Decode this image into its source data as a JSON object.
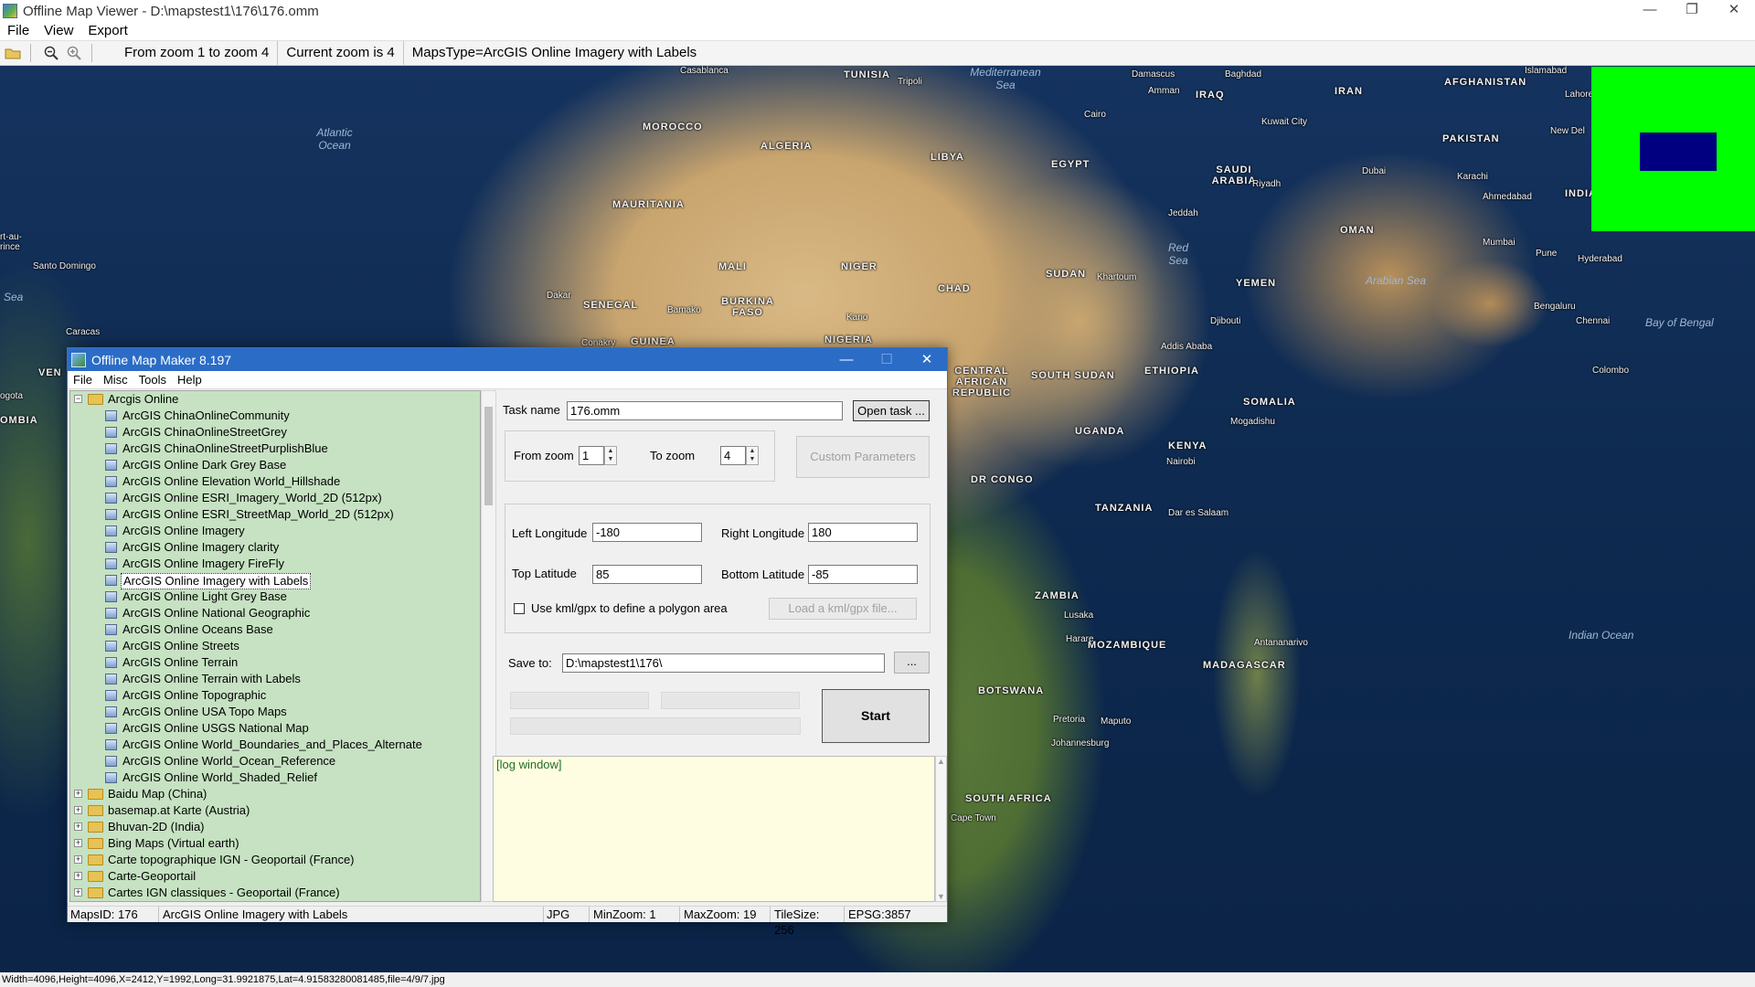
{
  "main_window": {
    "title": "Offline Map Viewer - D:\\mapstest1\\176\\176.omm",
    "controls": [
      "—",
      "❐",
      "✕"
    ]
  },
  "main_menu": [
    "File",
    "View",
    "Export"
  ],
  "toolbar": {
    "zoom_range": "From zoom 1 to zoom 4",
    "current_zoom": "Current zoom is 4",
    "maps_type": "MapsType=ArcGIS Online Imagery with Labels"
  },
  "map_labels": {
    "countries": [
      "TUNISIA",
      "MOROCCO",
      "ALGERIA",
      "LIBYA",
      "EGYPT",
      "SAUDI ARABIA",
      "IRAQ",
      "IRAN",
      "AFGHANISTAN",
      "PAKISTAN",
      "INDIA",
      "MAURITANIA",
      "MALI",
      "NIGER",
      "CHAD",
      "SUDAN",
      "YEMEN",
      "OMAN",
      "SENEGAL",
      "BURKINA FASO",
      "GUINEA",
      "NIGERIA",
      "CENTRAL AFRICAN REPUBLIC",
      "SOUTH SUDAN",
      "ETHIOPIA",
      "SOMALIA",
      "UGANDA",
      "KENYA",
      "DR CONGO",
      "TANZANIA",
      "ZAMBIA",
      "MOZAMBIQUE",
      "MADAGASCAR",
      "BOTSWANA",
      "SOUTH AFRICA",
      "VEN",
      "OMBIA"
    ],
    "cities": [
      "Casablanca",
      "Tripoli",
      "Damascus",
      "Baghdad",
      "Islamabad",
      "Lahore",
      "New Del",
      "Amman",
      "Cairo",
      "Kuwait City",
      "Riyadh",
      "Dubai",
      "Jeddah",
      "Karachi",
      "Ahmedabad",
      "Mumbai",
      "Pune",
      "Hyderabad",
      "Bengaluru",
      "Chennai",
      "Colombo",
      "Dakar",
      "Bamako",
      "Kano",
      "Conakry",
      "Khartoum",
      "Djibouti",
      "Addis Ababa",
      "Mogadishu",
      "Nairobi",
      "Dar es Salaam",
      "Lusaka",
      "Harare",
      "Antananarivo",
      "Pretoria",
      "Maputo",
      "Johannesburg",
      "Cape Town",
      "Santo Domingo",
      "Caracas",
      "ogota",
      "rt-au-rince"
    ],
    "oceans": [
      "Atlantic Ocean",
      "Mediterranean Sea",
      "Red Sea",
      "Arabian Sea",
      "Bay of Bengal",
      "Indian Ocean",
      "Sea"
    ]
  },
  "status_bar": "Width=4096,Height=4096,X=2412,Y=1992,Long=31.9921875,Lat=4.91583280081485,file=4/9/7.jpg",
  "dialog": {
    "title": "Offline Map Maker 8.197",
    "controls": [
      "—",
      "☐",
      "✕"
    ],
    "menu": [
      "File",
      "Misc",
      "Tools",
      "Help"
    ],
    "tree": {
      "root": "Arcgis Online",
      "children": [
        "ArcGIS ChinaOnlineCommunity",
        "ArcGIS ChinaOnlineStreetGrey",
        "ArcGIS ChinaOnlineStreetPurplishBlue",
        "ArcGIS Online Dark Grey Base",
        "ArcGIS Online Elevation World_Hillshade",
        "ArcGIS Online ESRI_Imagery_World_2D (512px)",
        "ArcGIS Online ESRI_StreetMap_World_2D (512px)",
        "ArcGIS Online Imagery",
        "ArcGIS Online Imagery clarity",
        "ArcGIS Online Imagery FireFly",
        "ArcGIS Online Imagery with Labels",
        "ArcGIS Online Light Grey Base",
        "ArcGIS Online National Geographic",
        "ArcGIS Online Oceans Base",
        "ArcGIS Online Streets",
        "ArcGIS Online Terrain",
        "ArcGIS Online Terrain with Labels",
        "ArcGIS Online Topographic",
        "ArcGIS Online USA Topo Maps",
        "ArcGIS Online USGS National Map",
        "ArcGIS Online World_Boundaries_and_Places_Alternate",
        "ArcGIS Online World_Ocean_Reference",
        "ArcGIS Online World_Shaded_Relief"
      ],
      "selected": "ArcGIS Online Imagery with Labels",
      "other_groups": [
        "Baidu Map (China)",
        "basemap.at Karte (Austria)",
        "Bhuvan-2D (India)",
        "Bing Maps (Virtual earth)",
        "Carte topographique IGN - Geoportail (France)",
        "Carte-Geoportail",
        "Cartes IGN classiques - Geoportail (France)"
      ]
    },
    "form": {
      "task_name_label": "Task name",
      "task_name_value": "176.omm",
      "open_task_button": "Open task ...",
      "from_zoom_label": "From zoom",
      "from_zoom_value": "1",
      "to_zoom_label": "To zoom",
      "to_zoom_value": "4",
      "custom_params_button": "Custom Parameters",
      "left_lon_label": "Left Longitude",
      "left_lon_value": "-180",
      "right_lon_label": "Right Longitude",
      "right_lon_value": "180",
      "top_lat_label": "Top Latitude",
      "top_lat_value": "85",
      "bottom_lat_label": "Bottom Latitude",
      "bottom_lat_value": "-85",
      "kml_checkbox_label": "Use kml/gpx to define a polygon area",
      "load_kml_button": "Load a kml/gpx file...",
      "save_to_label": "Save to:",
      "save_to_value": "D:\\mapstest1\\176\\",
      "browse_button": "...",
      "start_button": "Start"
    },
    "log": "[log window]",
    "status": {
      "maps_id": "MapsID: 176",
      "map_name": "ArcGIS Online Imagery with Labels",
      "format": "JPG",
      "min_zoom": "MinZoom: 1",
      "max_zoom": "MaxZoom: 19",
      "tile_size": "TileSize: 256",
      "epsg": "EPSG:3857"
    }
  }
}
